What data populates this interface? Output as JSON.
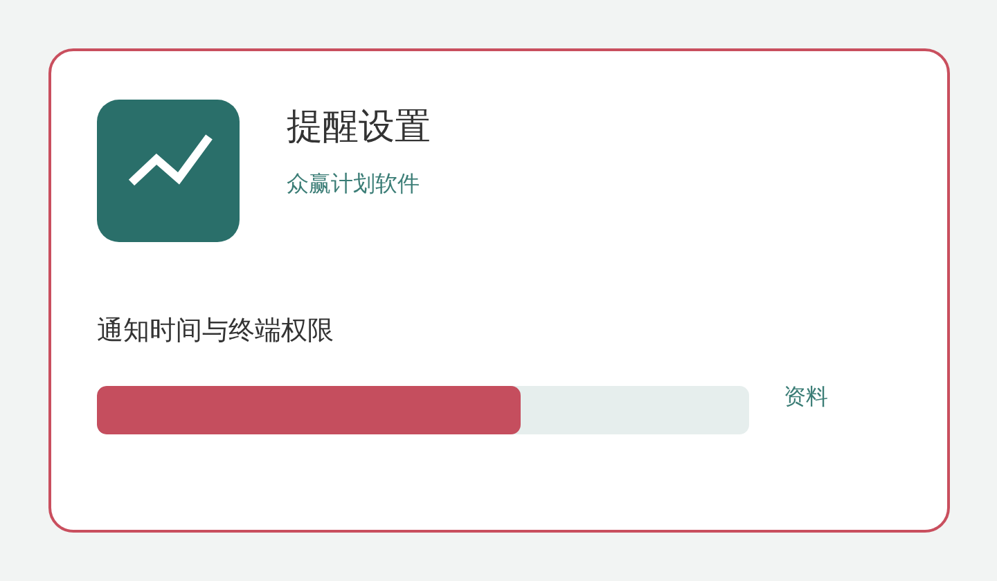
{
  "app": {
    "title": "提醒设置",
    "publisher": "众赢计划软件"
  },
  "permission": {
    "label": "通知时间与终端权限",
    "level": 0.65,
    "link": "资料"
  }
}
